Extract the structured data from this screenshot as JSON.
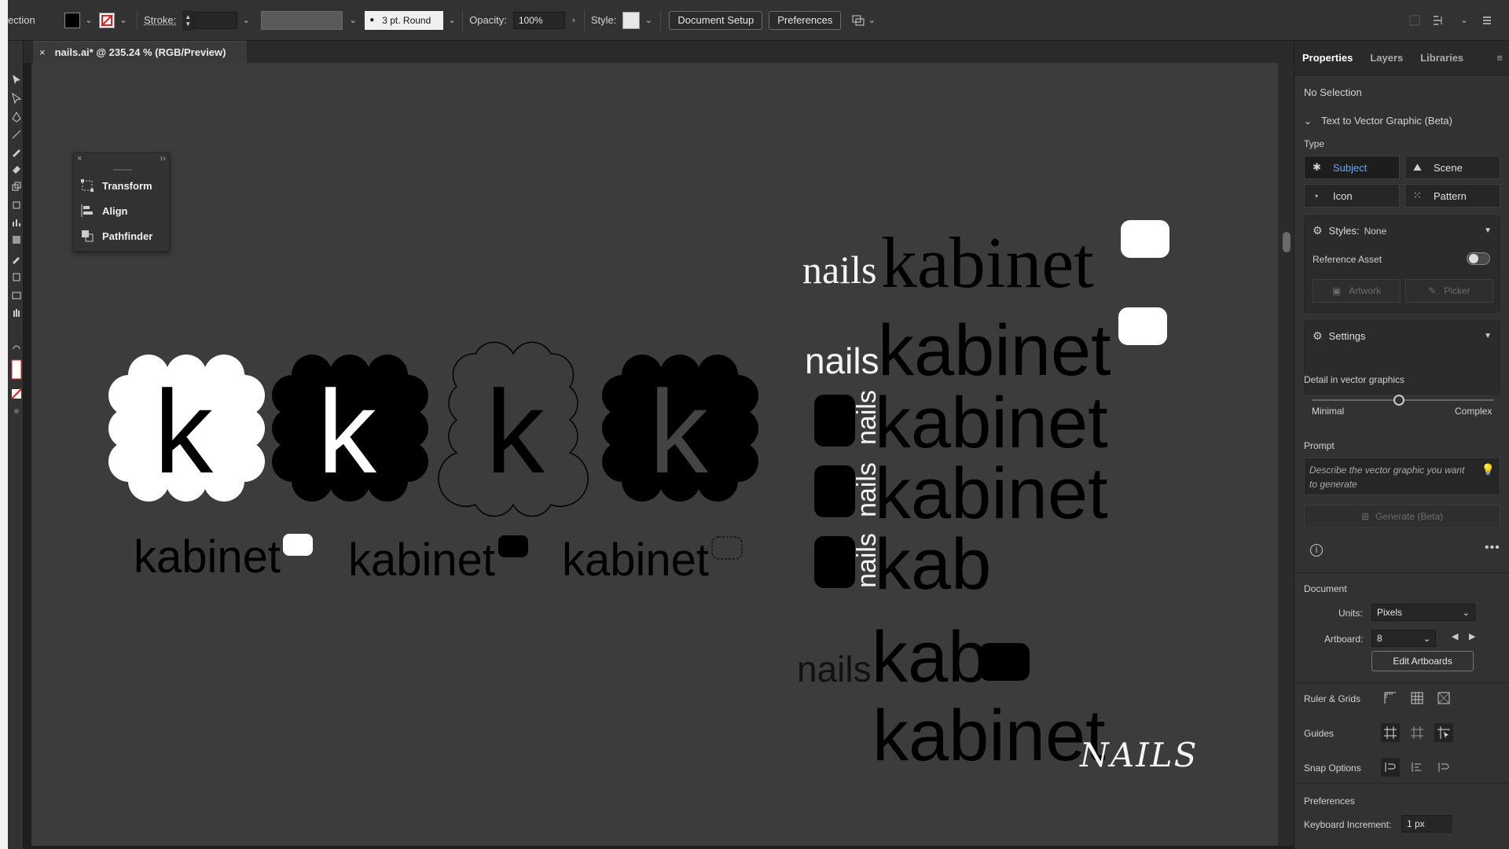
{
  "control_bar": {
    "selection_label": "ection",
    "stroke_label": "Stroke:",
    "brush_label": "3 pt. Round",
    "opacity_label": "Opacity:",
    "opacity_value": "100%",
    "style_label": "Style:",
    "document_setup_label": "Document Setup",
    "preferences_label": "Preferences"
  },
  "document_tab": {
    "close_glyph": "×",
    "title": "nails.ai* @ 235.24 % (RGB/Preview)"
  },
  "mini_panel": {
    "close_glyph": "×",
    "collapse_glyph": "››",
    "items": [
      {
        "label": "Transform",
        "icon": "transform-icon"
      },
      {
        "label": "Align",
        "icon": "align-icon"
      },
      {
        "label": "Pathfinder",
        "icon": "pathfinder-icon"
      }
    ]
  },
  "artwork": {
    "k_letter": "k",
    "kabinet": "kabinet",
    "nails": "nails",
    "kab": "kab",
    "nails_script": "NAILS"
  },
  "right_panel": {
    "tabs": [
      "Properties",
      "Layers",
      "Libraries"
    ],
    "no_selection": "No Selection",
    "section_title": "Text to Vector Graphic (Beta)",
    "type_label": "Type",
    "type_options": [
      {
        "label": "Subject",
        "icon": "subject-icon",
        "selected": true
      },
      {
        "label": "Scene",
        "icon": "scene-icon",
        "selected": false
      },
      {
        "label": "Icon",
        "icon": "icon-type-icon",
        "selected": false
      },
      {
        "label": "Pattern",
        "icon": "pattern-icon",
        "selected": false
      }
    ],
    "styles_label": "Styles:",
    "styles_value": "None",
    "reference_asset_label": "Reference Asset",
    "artwork_btn": "Artwork",
    "picker_btn": "Picker",
    "settings_label": "Settings",
    "detail_label": "Detail in vector graphics",
    "detail_min": "Minimal",
    "detail_max": "Complex",
    "detail_level": 0.48,
    "prompt_label": "Prompt",
    "prompt_placeholder": "Describe the vector graphic you want to generate",
    "generate_label": "Generate (Beta)",
    "document_label": "Document",
    "units_label": "Units:",
    "units_value": "Pixels",
    "artboard_label": "Artboard:",
    "artboard_value": "8",
    "edit_artboards_label": "Edit Artboards",
    "ruler_grids_label": "Ruler & Grids",
    "guides_label": "Guides",
    "snap_options_label": "Snap Options",
    "preferences_label": "Preferences",
    "keyboard_increment_label": "Keyboard Increment:",
    "keyboard_increment_value": "1 px"
  },
  "colors": {
    "canvas": "#3c3c3c",
    "panel": "#323232",
    "accent": "#62a9ff"
  }
}
